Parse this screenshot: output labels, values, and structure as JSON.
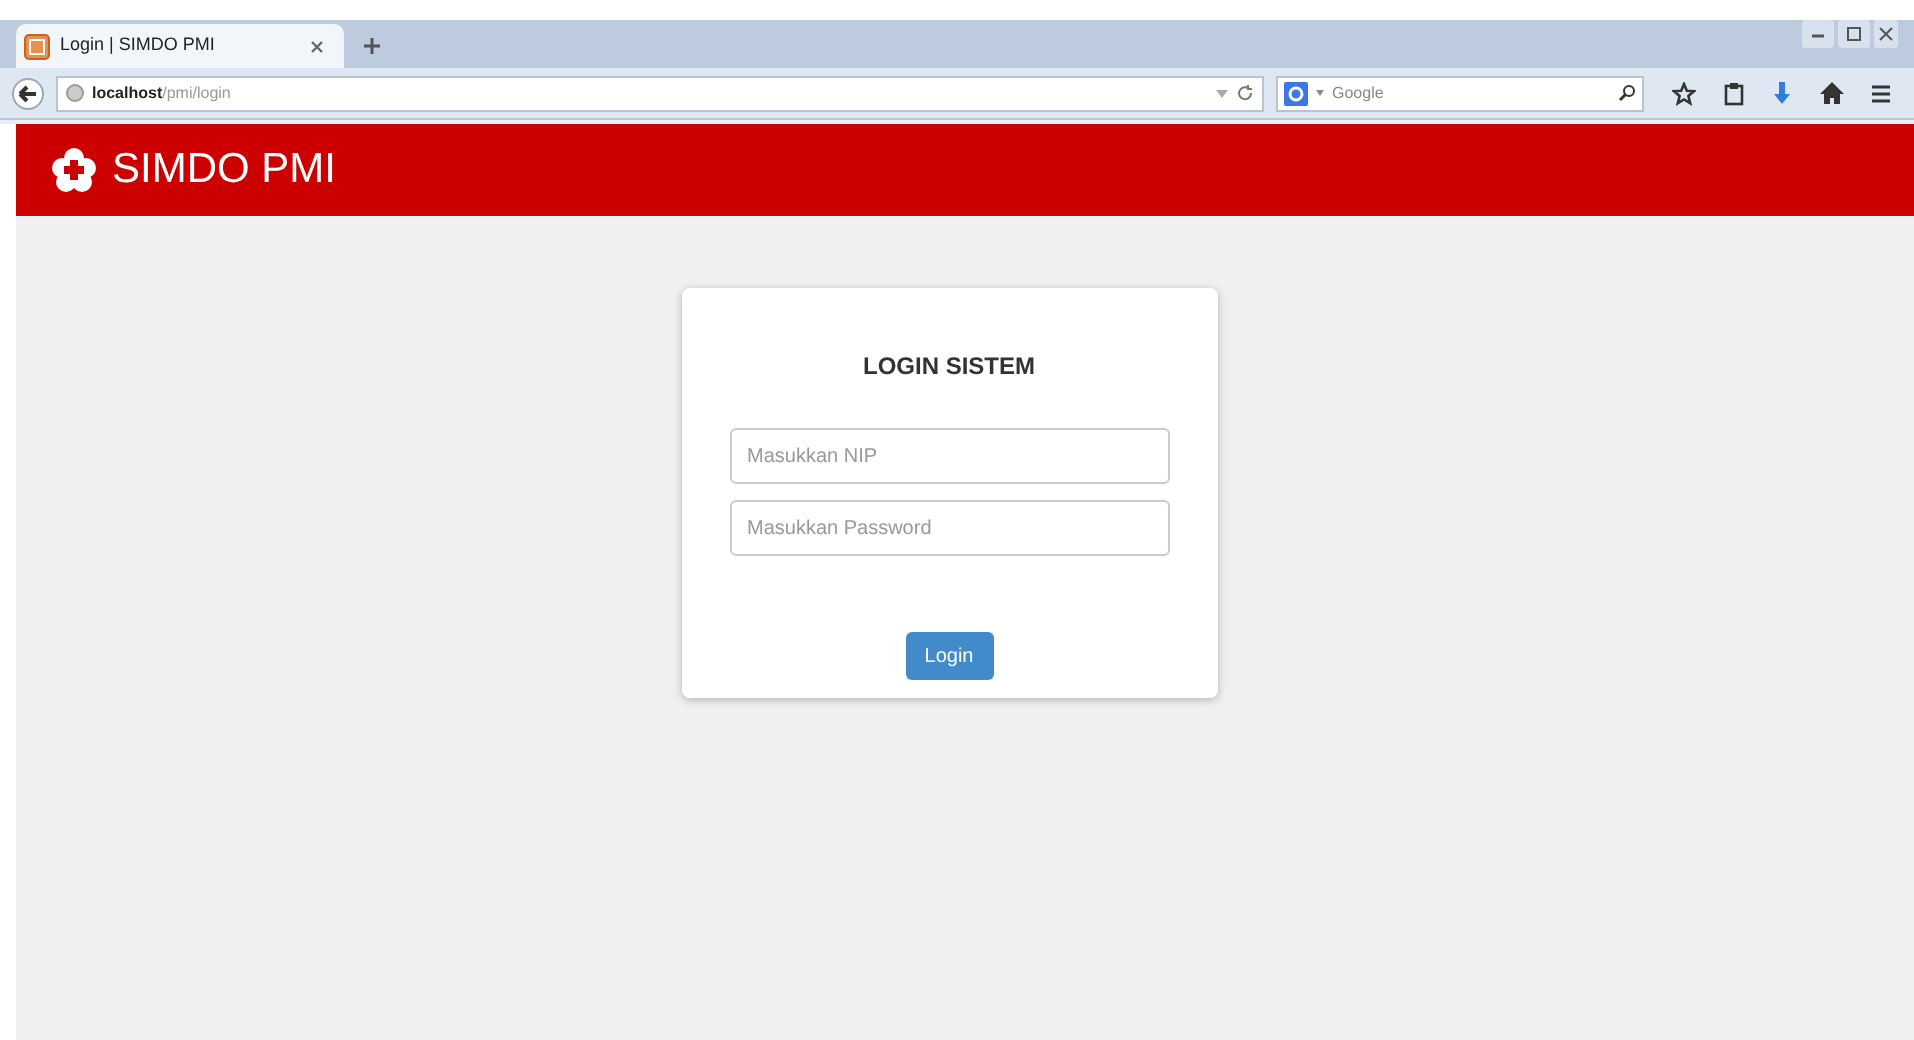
{
  "browser": {
    "tab_title": "Login | SIMDO PMI",
    "url_host": "localhost",
    "url_path": "/pmi/login",
    "search_placeholder": "Google"
  },
  "header": {
    "title": "SIMDO PMI"
  },
  "login": {
    "title": "LOGIN SISTEM",
    "fields": [
      {
        "placeholder": "Masukkan NIP"
      },
      {
        "placeholder": "Masukkan Password"
      }
    ],
    "button": "Login"
  }
}
